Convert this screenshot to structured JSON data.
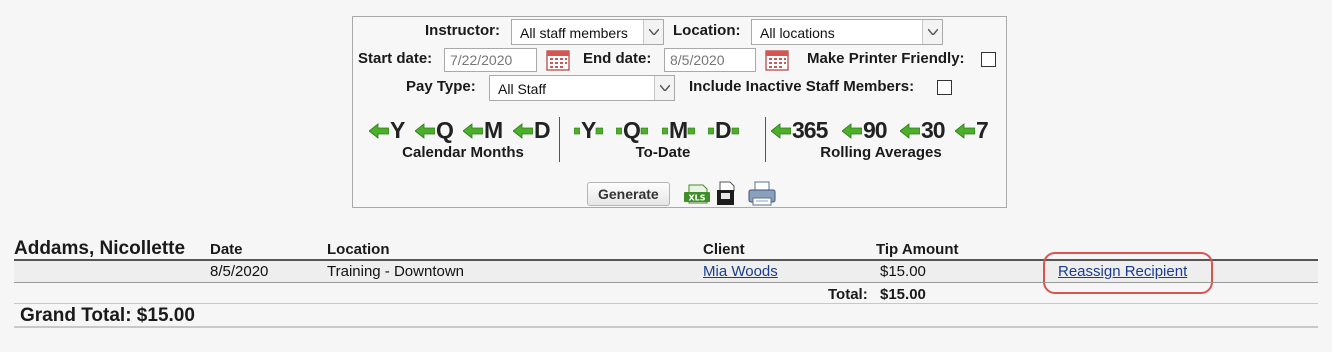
{
  "filters": {
    "instructor_label": "Instructor:",
    "instructor_value": "All staff members",
    "location_label": "Location:",
    "location_value": "All locations",
    "start_date_label": "Start date:",
    "start_date_value": "7/22/2020",
    "end_date_label": "End date:",
    "end_date_value": "8/5/2020",
    "printer_friendly_label": "Make Printer Friendly:",
    "pay_type_label": "Pay Type:",
    "pay_type_value": "All Staff",
    "inactive_label": "Include Inactive Staff Members:"
  },
  "ranges": {
    "calendar_months": {
      "label": "Calendar Months",
      "buttons": [
        "Y",
        "Q",
        "M",
        "D"
      ]
    },
    "to_date": {
      "label": "To-Date",
      "buttons": [
        "Y",
        "Q",
        "M",
        "D"
      ]
    },
    "rolling_averages": {
      "label": "Rolling Averages",
      "buttons": [
        "365",
        "90",
        "30",
        "7"
      ]
    }
  },
  "actions": {
    "generate_label": "Generate",
    "xls_label": "XLS"
  },
  "report": {
    "staff_name": "Addams, Nicollette",
    "columns": [
      "Date",
      "Location",
      "Client",
      "Tip Amount"
    ],
    "rows": [
      {
        "date": "8/5/2020",
        "location": "Training - Downtown",
        "client": "Mia Woods",
        "tip": "$15.00",
        "action": "Reassign Recipient"
      }
    ],
    "total_label": "Total:",
    "total_value": "$15.00",
    "grand_total": "Grand Total: $15.00"
  },
  "colors": {
    "arrow_green": "#4caf2a",
    "link_blue": "#1b3c8e",
    "highlight_red": "#d9534f"
  }
}
